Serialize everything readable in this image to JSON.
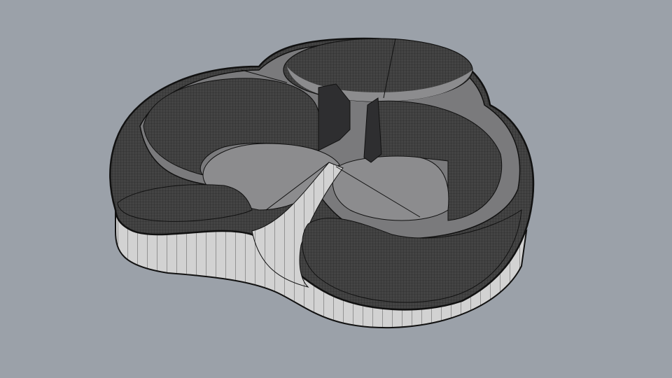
{
  "viewport": {
    "background_color": "#9ba1a9",
    "model_dark_color": "#3a3a3c",
    "model_mid_color": "#6e6e70",
    "model_floor_color": "#8c8c8e",
    "model_base_color": "#cfcfcf",
    "edge_color": "#111111"
  }
}
